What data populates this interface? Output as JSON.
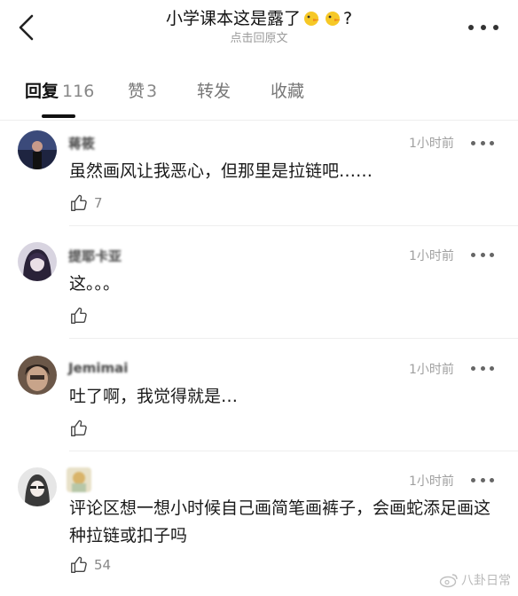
{
  "header": {
    "title_text": "小学课本这是露了",
    "title_suffix": "?",
    "subtitle": "点击回原文"
  },
  "tabs": [
    {
      "label": "回复",
      "count": "116",
      "active": true
    },
    {
      "label": "赞",
      "count": "3",
      "active": false
    },
    {
      "label": "转发",
      "count": "",
      "active": false
    },
    {
      "label": "收藏",
      "count": "",
      "active": false
    }
  ],
  "comments": [
    {
      "username": "蒋筱",
      "time": "1小时前",
      "text": "虽然画风让我恶心，但那里是拉链吧……",
      "likes": "7"
    },
    {
      "username": "提耶卡亚",
      "time": "1小时前",
      "text": "这。。。",
      "likes": ""
    },
    {
      "username": "Jemimai",
      "time": "1小时前",
      "text": "吐了啊，我觉得就是…",
      "likes": ""
    },
    {
      "username": "",
      "time": "1小时前",
      "text": "评论区想一想小时候自己画简笔画裤子，会画蛇添足画这种拉链或扣子吗",
      "likes": "54"
    }
  ],
  "watermark": "八卦日常"
}
